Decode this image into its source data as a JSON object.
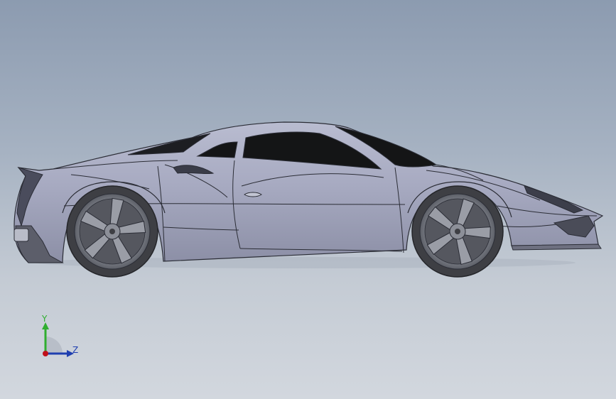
{
  "viewport": {
    "background_top": "#8c9bb0",
    "background_bottom": "#d2d7de",
    "model": "sports-car-side-view"
  },
  "triad": {
    "y_label": "Y",
    "z_label": "Z",
    "colors": {
      "y": "#2fae2f",
      "z": "#1f3fb0",
      "x": "#c0101a"
    }
  },
  "colors": {
    "body": "#a7aac1",
    "body_shadow": "#8a8ca3",
    "glass": "#141516",
    "tire": "#3e3f44",
    "rim": "#8f929b",
    "edges": "#2b2d36"
  }
}
